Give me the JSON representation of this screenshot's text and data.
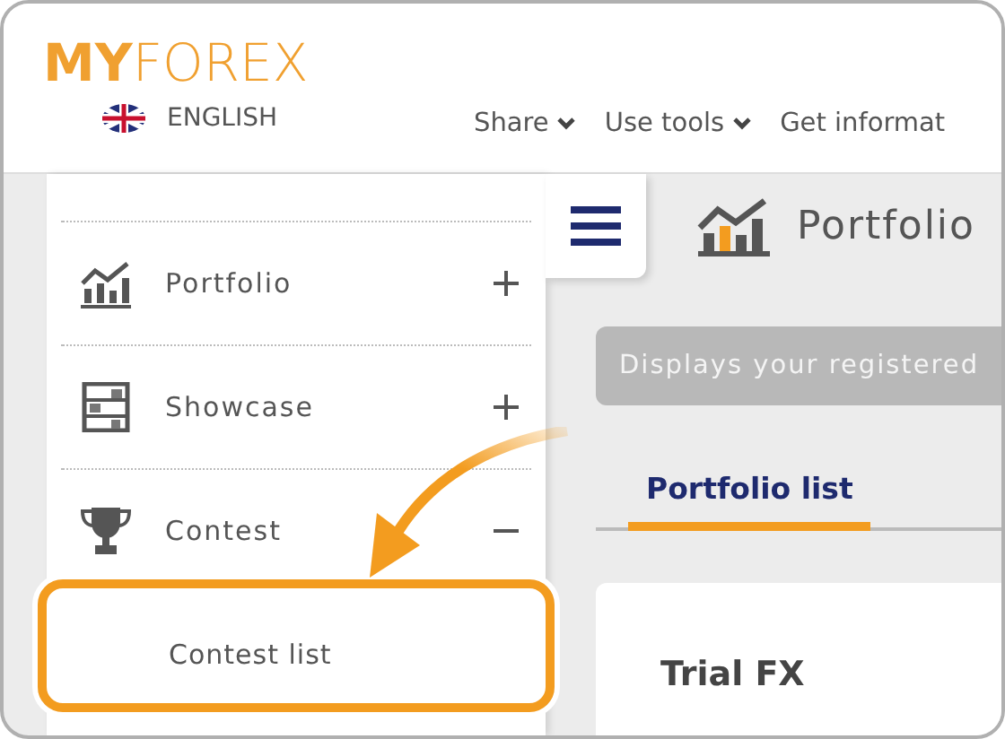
{
  "header": {
    "logo": "**MY**FOREX",
    "language": "ENGLISH",
    "nav": [
      {
        "label": "Share",
        "dropdown": true
      },
      {
        "label": "Use tools",
        "dropdown": true
      },
      {
        "label": "Get informat",
        "dropdown": false
      }
    ]
  },
  "sidebar": {
    "items": [
      {
        "label": "Portfolio",
        "expanded": false
      },
      {
        "label": "Showcase",
        "expanded": false
      },
      {
        "label": "Contest",
        "expanded": true,
        "children": [
          {
            "label": "Contest list"
          }
        ]
      }
    ]
  },
  "main": {
    "title": "Portfolio",
    "banner": "Displays your registered",
    "tabs": [
      {
        "label": "Portfolio list",
        "selected": true
      }
    ],
    "card": {
      "title": "Trial FX"
    }
  }
}
